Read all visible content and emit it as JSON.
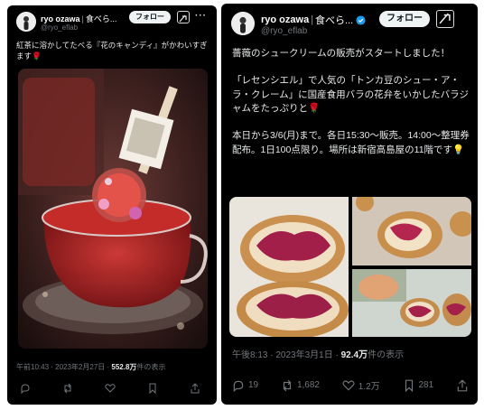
{
  "left_post": {
    "author_name": "ryo ozawa",
    "separator": "|",
    "author_tag": "食べら...",
    "handle": "@ryo_eflab",
    "follow_label": "フォロー",
    "text": "紅茶に溶かしてたべる『花のキャンディ』がかわいすぎます🌹",
    "timestamp": "午前10:43 · 2023年2月27日 · ",
    "views_count": "552.8万",
    "views_suffix": "件の表示",
    "actions": {
      "reply_icon": "reply-icon",
      "repost_icon": "repost-icon",
      "like_icon": "heart-icon",
      "bookmark_icon": "bookmark-icon"
    }
  },
  "right_post": {
    "author_name": "ryo ozawa",
    "separator": "|",
    "author_tag": "食べら...",
    "handle": "@ryo_eflab",
    "follow_label": "フォロー",
    "text": "薔薇のシュークリームの販売がスタートしました！\n\n「レセンシエル」で人気の「トンカ豆のシュー・ア・ラ・クレーム」に国産食用バラの花弁をいかしたバラジャムをたっぷりと🌹\n\n本日から3/6(月)まで。各日15:30〜販売。14:00〜整理券配布。1日100点限り。場所は新宿高島屋の11階です💡",
    "timestamp": "午後8:13 · 2023年3月1日 · ",
    "views_count": "92.4万",
    "views_suffix": "件の表示",
    "actions": {
      "reply_count": "19",
      "repost_count": "1,682",
      "like_count": "1.2万",
      "bookmark_count": "281"
    }
  },
  "colors": {
    "background": "#000000",
    "text": "#e7e9ea",
    "muted": "#71767b",
    "verified": "#1d9bf0",
    "follow_bg": "#eff3f4"
  }
}
